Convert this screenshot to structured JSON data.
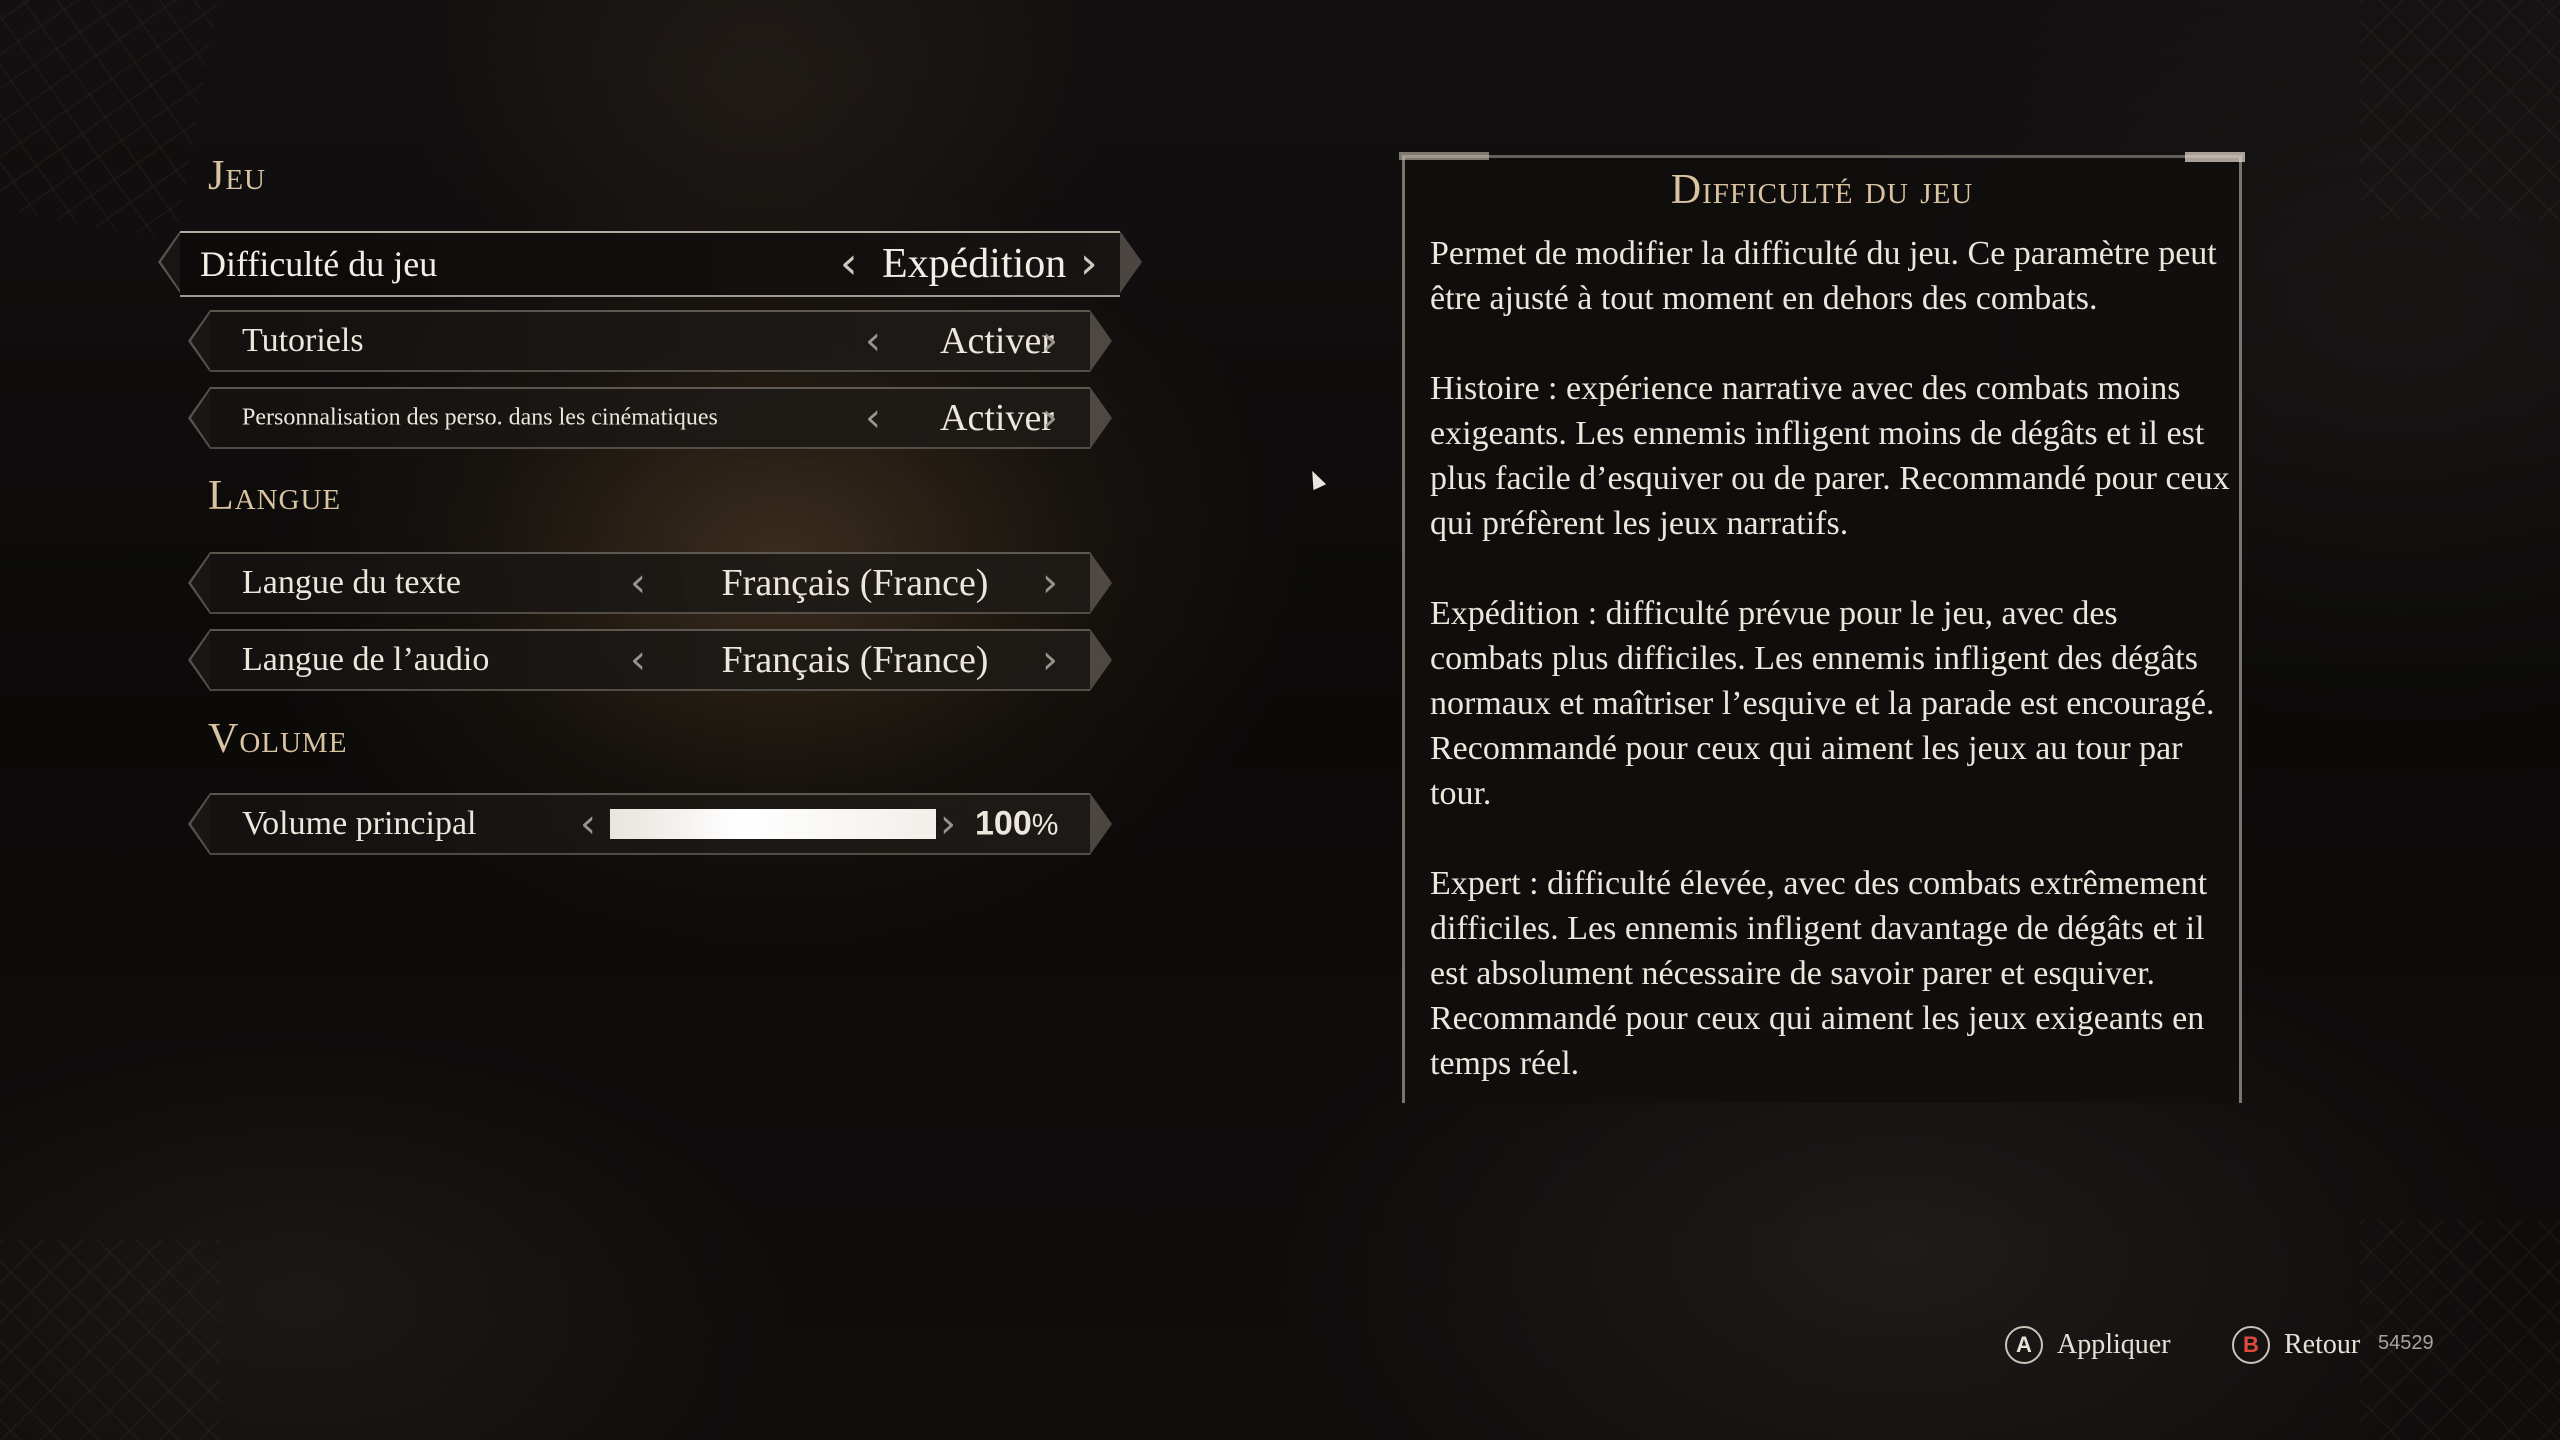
{
  "sections": {
    "game": {
      "title": "Jeu",
      "difficulty": {
        "label": "Difficulté du jeu",
        "value": "Expédition"
      },
      "tutorials": {
        "label": "Tutoriels",
        "value": "Activer"
      },
      "customization": {
        "label": "Personnalisation des perso. dans les cinématiques",
        "value": "Activer"
      }
    },
    "language": {
      "title": "Langue",
      "text": {
        "label": "Langue du texte",
        "value": "Français (France)"
      },
      "audio": {
        "label": "Langue de l’audio",
        "value": "Français (France)"
      }
    },
    "volume": {
      "title": "Volume",
      "master": {
        "label": "Volume principal",
        "percent": 100,
        "percent_text": "100",
        "unit": "%"
      }
    }
  },
  "info_panel": {
    "title": "Difficulté du jeu",
    "paragraphs": [
      "Permet de modifier la difficulté du jeu. Ce paramètre peut être ajusté à tout moment en dehors des combats.",
      "Histoire : expérience narrative avec des combats moins exigeants. Les ennemis infligent moins de dégâts et il est plus facile d’esquiver ou de parer. Recommandé pour ceux qui préfèrent les jeux narratifs.",
      "Expédition : difficulté prévue pour le jeu, avec des combats plus difficiles. Les ennemis infligent des dégâts normaux et maîtriser l’esquive et la parade est encouragé. Recommandé pour ceux qui aiment les jeux au tour par tour.",
      "Expert : difficulté élevée, avec des combats extrêmement difficiles. Les ennemis infligent davantage de dégâts et il est absolument nécessaire de savoir parer et esquiver. Recommandé pour ceux qui aiment les jeux exigeants en temps réel."
    ]
  },
  "footer": {
    "apply": {
      "button": "A",
      "label": "Appliquer"
    },
    "back": {
      "button": "B",
      "label": "Retour"
    },
    "build_id": "54529"
  },
  "icons": {
    "left_arrow": "chevron-left-icon",
    "right_arrow": "chevron-right-icon"
  },
  "colors": {
    "section_title": "#d9c3a1",
    "text": "#ece6dc",
    "b_button": "#e04a3c"
  }
}
